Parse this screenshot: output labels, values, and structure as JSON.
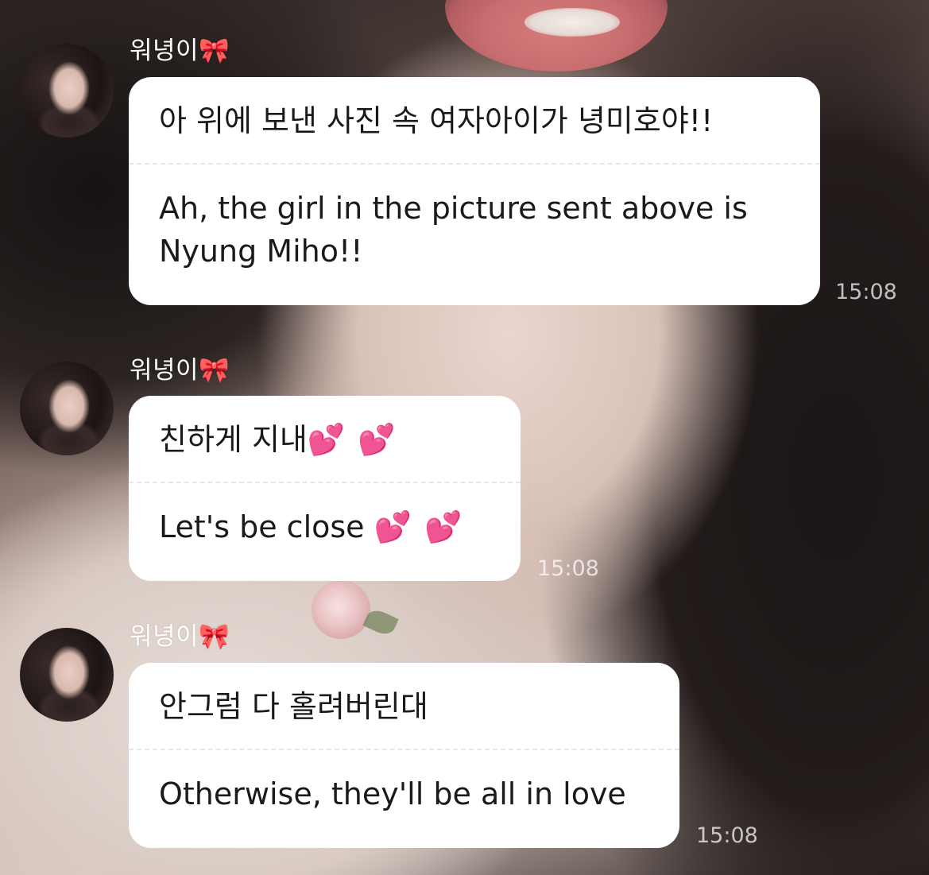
{
  "messages": [
    {
      "sender": "워녕이",
      "sender_emoji": "🎀",
      "korean": "아 위에 보낸 사진 속 여자아이가 녕미호야!!",
      "english": "Ah, the girl in the picture sent above is Nyung Miho!!",
      "time": "15:08"
    },
    {
      "sender": "워녕이",
      "sender_emoji": "🎀",
      "korean": "친하게 지내",
      "korean_emoji": "💕 💕",
      "english": "Let's be close",
      "english_emoji": "💕 💕",
      "time": "15:08"
    },
    {
      "sender": "워녕이",
      "sender_emoji": "🎀",
      "korean": "안그럼 다 홀려버린대",
      "english": "Otherwise, they'll be all in love",
      "time": "15:08"
    }
  ],
  "icons": {
    "avatar": "profile-photo",
    "bow": "ribbon-bow-emoji",
    "hearts": "two-hearts-emoji"
  }
}
